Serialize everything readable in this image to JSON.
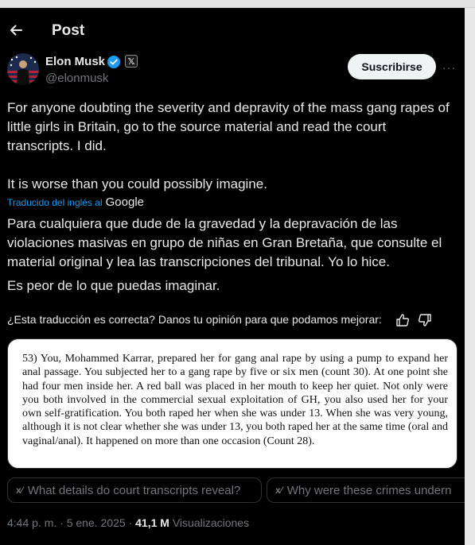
{
  "header": {
    "title": "Post"
  },
  "author": {
    "name": "Elon Musk",
    "handle": "@elonmusk"
  },
  "actions": {
    "subscribe": "Suscribirse",
    "more": "···"
  },
  "post": {
    "original": [
      "For anyone doubting the severity and depravity of the mass gang rapes of little girls in Britain, go to the source material and read the court transcripts. I did.",
      "It is worse than you could possibly imagine."
    ],
    "translated_by": "Traducido del inglés al",
    "translator": "Google",
    "translation": [
      "Para cualquiera que dude de la gravedad y la depravación de las violaciones masivas en grupo de niñas en Gran Bretaña, que consulte el material original y lea las transcripciones del tribunal. Yo lo hice.",
      "Es peor de lo que puedas imaginar."
    ],
    "feedback_question": "¿Esta traducción es correcta? Danos tu opinión para que podamos mejorar:"
  },
  "media": {
    "text": "53)  You, Mohammed Karrar, prepared her for gang anal rape by using a pump to expand her anal passage.  You subjected her to a gang rape by five or six men (count 30). At one point she had four men inside her. A red ball was placed in her mouth to keep her quiet. Not only were you both involved in the commercial sexual exploitation of  GH, you also used her for your own self-gratification. You both raped her when she was under 13. When she was very young, although it is not clear whether she was under 13, you both raped her at the same time (oral and vaginal/anal). It happened on more than one occasion (Count 28)."
  },
  "grok_prompts": [
    {
      "icon": "grok-icon",
      "label": "What details do court transcripts reveal?"
    },
    {
      "icon": "grok-icon",
      "label": "Why were these crimes undern"
    }
  ],
  "meta": {
    "time": "4:44 p. m.",
    "separator": "·",
    "date": "5 ene. 2025",
    "views_count": "41,1 M",
    "views_label": "Visualizaciones"
  },
  "colors": {
    "accent": "#1d9bf0",
    "background": "#000000",
    "text": "#e7e9ea",
    "muted": "#71767b"
  }
}
